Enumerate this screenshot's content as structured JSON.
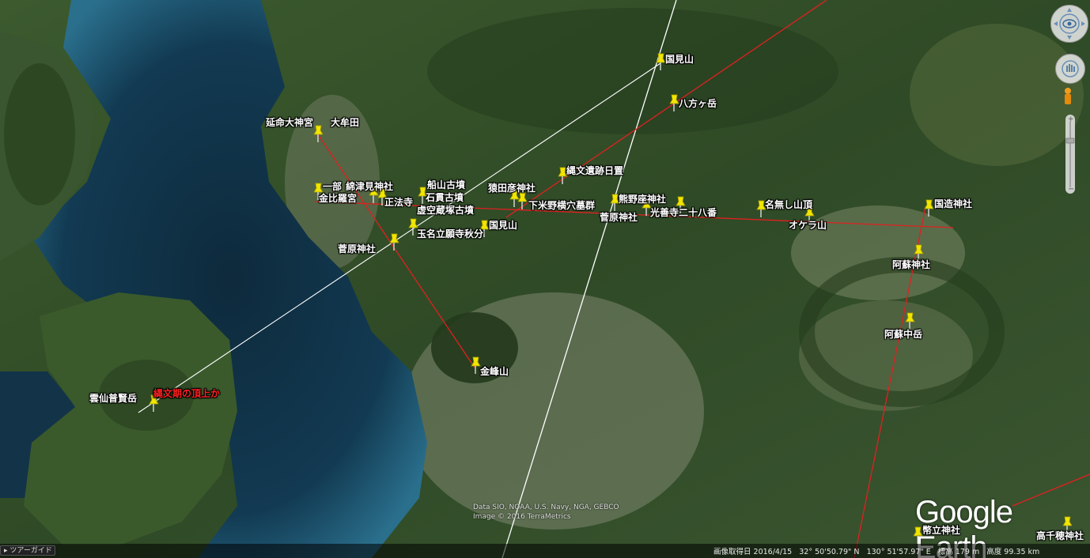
{
  "labels": {
    "kunimiyama_n": "国見山",
    "happogatake": "八方ヶ岳",
    "enmei": "延命大神宮",
    "omuta": "大牟田",
    "ichibu": "一部",
    "wata": "綿津見神社",
    "konpira": "金比羅宮",
    "shoho": "正法寺",
    "funayama": "船山古墳",
    "ishinuki": "石貫古墳",
    "kokuzo_kofun": "虚空蔵塚古墳",
    "sarutahiko": "猿田彦神社",
    "jomon_iseki": "縄文遺跡日置",
    "kumanoza": "熊野座神社",
    "shimokumeno": "下米野横穴墓群",
    "sugawara1": "菅原神社",
    "kozenji": "光善寺二十八番",
    "nanashi": "名無し山頂",
    "okera": "オケラ山",
    "kokuzo_jinja": "国造神社",
    "tamana": "玉名立願寺秋分",
    "kunimiyama_s": "国見山",
    "sugawara2": "菅原神社",
    "aso_jinja": "阿蘇神社",
    "aso_nakadake": "阿蘇中岳",
    "kinpozan": "金峰山",
    "fugendake": "雲仙普賢岳",
    "jomon_peak": "縄文期の頂上か",
    "heitate": "幣立神社",
    "takachiho": "高千穂神社"
  },
  "attribution": {
    "line1": "Data SIO, NOAA, U.S. Navy, NGA, GEBCO",
    "line2": "Image © 2016 TerraMetrics"
  },
  "logo": "Google Earth",
  "tour_label": "▸ ツアーガイド",
  "status": {
    "date": "画像取得日 2016/4/15",
    "lat": "32° 50'50.79\" N",
    "lon": "130° 51'57.97\" E",
    "elev": "標高 179 m",
    "alt": "高度 99.35 km"
  },
  "colors": {
    "pin": "#f2e600",
    "red_line": "#e02020",
    "white_line": "#ffffff"
  }
}
